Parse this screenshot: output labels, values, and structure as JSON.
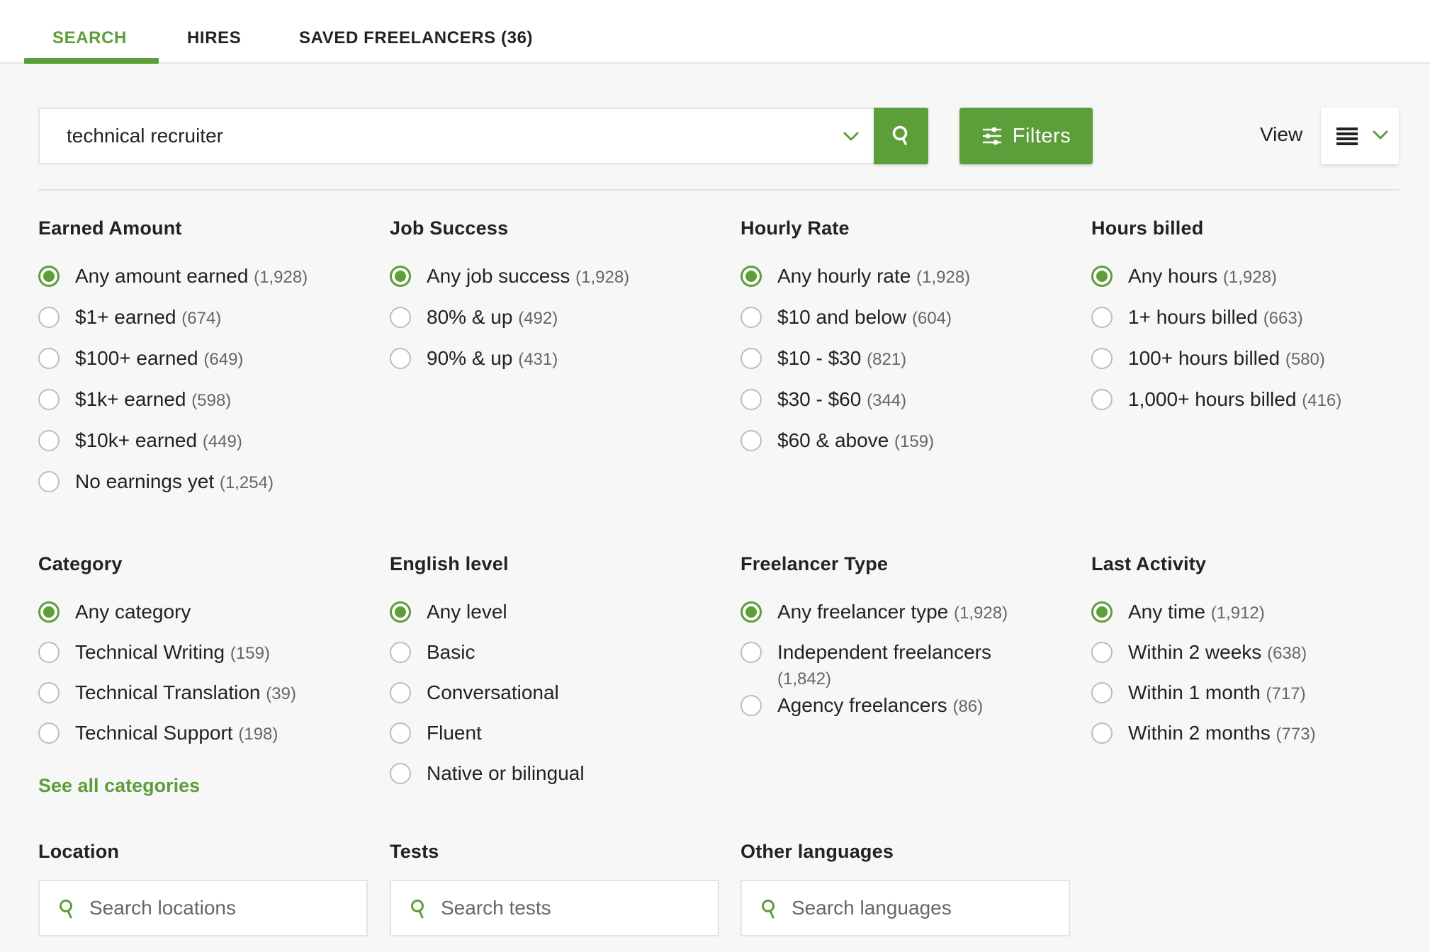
{
  "tabs": [
    {
      "label": "SEARCH",
      "active": true
    },
    {
      "label": "HIRES",
      "active": false
    },
    {
      "label": "SAVED FREELANCERS (36)",
      "active": false
    }
  ],
  "search": {
    "value": "technical recruiter",
    "filters_label": "Filters",
    "view_label": "View"
  },
  "colors": {
    "accent": "#5c9e3a",
    "text": "#222222",
    "count": "#666666",
    "background": "#f7f7f7"
  },
  "sections": [
    {
      "title": "Earned Amount",
      "options": [
        {
          "label": "Any amount earned",
          "count": "(1,928)",
          "checked": true
        },
        {
          "label": "$1+ earned",
          "count": "(674)",
          "checked": false
        },
        {
          "label": "$100+ earned",
          "count": "(649)",
          "checked": false
        },
        {
          "label": "$1k+ earned",
          "count": "(598)",
          "checked": false
        },
        {
          "label": "$10k+ earned",
          "count": "(449)",
          "checked": false
        },
        {
          "label": "No earnings yet",
          "count": "(1,254)",
          "checked": false
        }
      ]
    },
    {
      "title": "Job Success",
      "options": [
        {
          "label": "Any job success",
          "count": "(1,928)",
          "checked": true
        },
        {
          "label": "80% & up",
          "count": "(492)",
          "checked": false
        },
        {
          "label": "90% & up",
          "count": "(431)",
          "checked": false
        }
      ]
    },
    {
      "title": "Hourly Rate",
      "options": [
        {
          "label": "Any hourly rate",
          "count": "(1,928)",
          "checked": true
        },
        {
          "label": "$10 and below",
          "count": "(604)",
          "checked": false
        },
        {
          "label": "$10 - $30",
          "count": "(821)",
          "checked": false
        },
        {
          "label": "$30 - $60",
          "count": "(344)",
          "checked": false
        },
        {
          "label": "$60 & above",
          "count": "(159)",
          "checked": false
        }
      ]
    },
    {
      "title": "Hours billed",
      "options": [
        {
          "label": "Any hours",
          "count": "(1,928)",
          "checked": true
        },
        {
          "label": "1+ hours billed",
          "count": "(663)",
          "checked": false
        },
        {
          "label": "100+ hours billed",
          "count": "(580)",
          "checked": false
        },
        {
          "label": "1,000+ hours billed",
          "count": "(416)",
          "checked": false
        }
      ]
    },
    {
      "title": "Category",
      "options": [
        {
          "label": "Any category",
          "count": "",
          "checked": true
        },
        {
          "label": "Technical Writing",
          "count": "(159)",
          "checked": false
        },
        {
          "label": "Technical Translation",
          "count": "(39)",
          "checked": false
        },
        {
          "label": "Technical Support",
          "count": "(198)",
          "checked": false
        }
      ],
      "link": "See all categories"
    },
    {
      "title": "English level",
      "options": [
        {
          "label": "Any level",
          "count": "",
          "checked": true
        },
        {
          "label": "Basic",
          "count": "",
          "checked": false
        },
        {
          "label": "Conversational",
          "count": "",
          "checked": false
        },
        {
          "label": "Fluent",
          "count": "",
          "checked": false
        },
        {
          "label": "Native or bilingual",
          "count": "",
          "checked": false
        }
      ]
    },
    {
      "title": "Freelancer Type",
      "options": [
        {
          "label": "Any freelancer type",
          "count": "(1,928)",
          "checked": true
        },
        {
          "label": "Independent freelancers",
          "count": "(1,842)",
          "checked": false
        },
        {
          "label": "Agency freelancers",
          "count": "(86)",
          "checked": false
        }
      ]
    },
    {
      "title": "Last Activity",
      "options": [
        {
          "label": "Any time",
          "count": "(1,912)",
          "checked": true
        },
        {
          "label": "Within 2 weeks",
          "count": "(638)",
          "checked": false
        },
        {
          "label": "Within 1 month",
          "count": "(717)",
          "checked": false
        },
        {
          "label": "Within 2 months",
          "count": "(773)",
          "checked": false
        }
      ]
    }
  ],
  "search_filters": [
    {
      "title": "Location",
      "placeholder": "Search locations"
    },
    {
      "title": "Tests",
      "placeholder": "Search tests"
    },
    {
      "title": "Other languages",
      "placeholder": "Search languages"
    }
  ]
}
